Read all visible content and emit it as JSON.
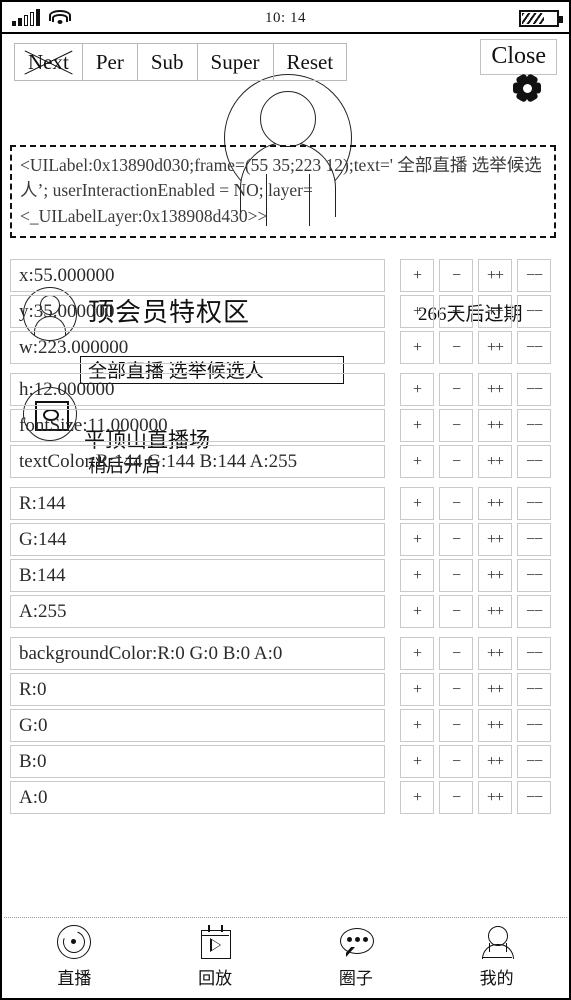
{
  "status_bar": {
    "time": "10: 14",
    "signal_icon": "signal-bars-icon",
    "wifi_icon": "wifi-icon",
    "battery_icon": "battery-icon"
  },
  "toolbar": {
    "nav_buttons": [
      {
        "label": "Next",
        "crossed": true
      },
      {
        "label": "Per",
        "crossed": false
      },
      {
        "label": "Sub",
        "crossed": false
      },
      {
        "label": "Super",
        "crossed": false
      },
      {
        "label": "Reset",
        "crossed": false
      }
    ],
    "close_label": "Close",
    "gear_icon": "gear-icon"
  },
  "description": {
    "text": "<UILabel:0x13890d030;frame=(55 35;223 12);text=' 全部直播 选举候选人’; userInteractionEnabled = NO; layer=<_UILabelLayer:0x138908d430>>"
  },
  "properties": [
    {
      "label": "x:55.000000",
      "group_end": false
    },
    {
      "label": "y:35.000000",
      "group_end": false
    },
    {
      "label": "w:223.000000",
      "group_end": true
    },
    {
      "label": "h:12.000000",
      "group_end": false
    },
    {
      "label": "fontSize:11.000000",
      "group_end": false
    },
    {
      "label": "textColor:R:144 G:144 B:144 A:255",
      "group_end": true
    },
    {
      "label": "R:144",
      "group_end": false
    },
    {
      "label": "G:144",
      "group_end": false
    },
    {
      "label": "B:144",
      "group_end": false
    },
    {
      "label": "A:255",
      "group_end": true
    },
    {
      "label": "backgroundColor:R:0 G:0 B:0 A:0",
      "group_end": false
    },
    {
      "label": "R:0",
      "group_end": false
    },
    {
      "label": "G:0",
      "group_end": false
    },
    {
      "label": "B:0",
      "group_end": false
    },
    {
      "label": "A:0",
      "group_end": false
    }
  ],
  "stepper_columns": [
    {
      "name": "increment",
      "label": "+"
    },
    {
      "name": "decrement",
      "label": "−"
    },
    {
      "name": "increment-large",
      "label": "++"
    },
    {
      "name": "decrement-large",
      "label": "−−"
    }
  ],
  "background_app": {
    "vip_title": "顶会员特权区",
    "expire_text": "266天后过期",
    "search_text": "全部直播 选举候选人",
    "room_title": "平顶山直播场",
    "room_status": "稍后开启",
    "avatar_icon": "avatar-placeholder-icon",
    "thumb_icon": "image-placeholder-icon"
  },
  "tab_bar": [
    {
      "label": "直播",
      "icon": "live-icon",
      "name": "tab-live"
    },
    {
      "label": "回放",
      "icon": "replay-icon",
      "name": "tab-replay"
    },
    {
      "label": "圈子",
      "icon": "circle-icon",
      "name": "tab-circle"
    },
    {
      "label": "我的",
      "icon": "profile-icon",
      "name": "tab-profile"
    }
  ],
  "colors": {
    "ink": "#111111",
    "row_border": "#c9c9c9",
    "muted_text": "#3a3a3a"
  }
}
